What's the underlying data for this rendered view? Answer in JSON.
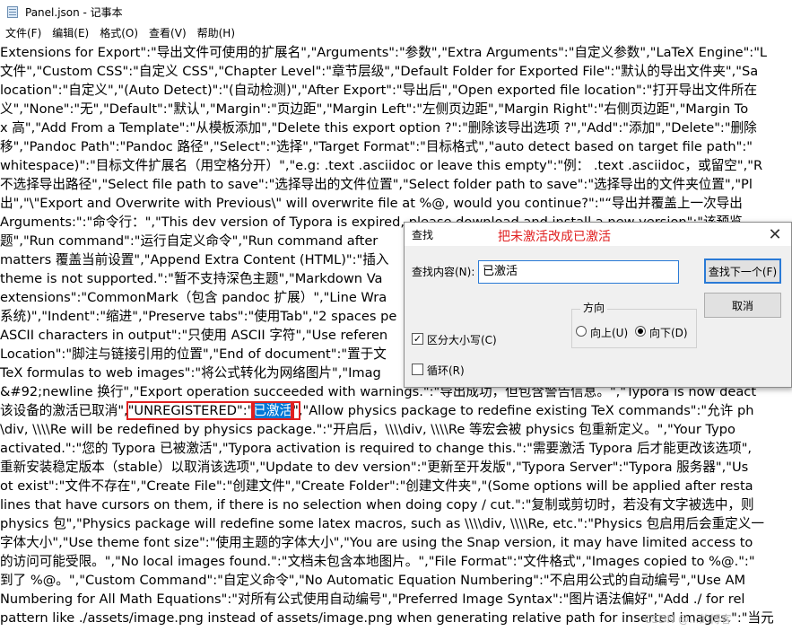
{
  "window": {
    "title": "Panel.json - 记事本",
    "icon": "notepad-icon"
  },
  "menu": [
    {
      "label": "文件(F)"
    },
    {
      "label": "编辑(E)"
    },
    {
      "label": "格式(O)"
    },
    {
      "label": "查看(V)"
    },
    {
      "label": "帮助(H)"
    }
  ],
  "editor": {
    "lines": [
      [
        "Extensions for Export\":\"导出文件可使用的扩展名\",\"Arguments\":\"参数\",\"Extra Arguments\":\"自定义参数\",\"LaTeX Engine\":\"L"
      ],
      [
        "文件\",\"Custom CSS\":\"自定义 CSS\",\"Chapter Level\":\"章节层级\",\"Default Folder for Exported File\":\"默认的导出文件夹\",\"Sa"
      ],
      [
        "location\":\"自定义\",\"(Auto Detect)\":\"(自动检测)\",\"After Export\":\"导出后\",\"Open exported file location\":\"打开导出文件所在"
      ],
      [
        "义\",\"None\":\"无\",\"Default\":\"默认\",\"Margin\":\"页边距\",\"Margin Left\":\"左侧页边距\",\"Margin Right\":\"右侧页边距\",\"Margin To"
      ],
      [
        "x 高\",\"Add From a Template\":\"从模板添加\",\"Delete this export option ?\":\"删除该导出选项 ?\",\"Add\":\"添加\",\"Delete\":\"删除"
      ],
      [
        "移\",\"Pandoc Path\":\"Pandoc 路径\",\"Select\":\"选择\",\"Target Format\":\"目标格式\",\"auto detect based on target file path\":\""
      ],
      [
        "whitespace)\":\"目标文件扩展名（用空格分开）\",\"e.g: .text .asciidoc or leave this empty\":\"例： .text .asciidoc，或留空\",\"R"
      ],
      [
        "不选择导出路径\",\"Select file path to save\":\"选择导出的文件位置\",\"Select folder path to save\":\"选择导出的文件夹位置\",\"Pl"
      ],
      [
        "出\",\"\\\"Export and Overwrite with Previous\\\" will overwrite file at %@, would you continue?\":\"“导出并覆盖上一次导出"
      ],
      [
        "Arguments:\":\"命令行：\",\"This dev version of Typora is expired, please download and install a new version\":\"该预览"
      ],
      [
        "题\",\"Run command\":\"运行自定义命令\",\"Run command after"
      ],
      [
        "matters 覆盖当前设置\",\"Append Extra Content (HTML)\":\"插入"
      ],
      [
        "theme is not supported.\":\"暂不支持深色主题\",\"Markdown Va"
      ],
      [
        "extensions\":\"CommonMark（包含 pandoc 扩展）\",\"Line Wra"
      ],
      [
        "系统)\",\"Indent\":\"缩进\",\"Preserve tabs\":\"使用Tab\",\"2 spaces pe"
      ],
      [
        "ASCII characters in output\":\"只使用 ASCII 字符\",\"Use referen"
      ],
      [
        "Location\":\"脚注与链接引用的位置\",\"End of document\":\"置于文"
      ],
      [
        "TeX formulas to web images\":\"将公式转化为网络图片\",\"Imag"
      ],
      [
        "&#92;newline 换行\",\"Export operation succeeded with warnings.\":\"导出成功，但包含警告信息。\",\"Typora is now deact"
      ],
      [
        "该设备的激活已取消\",",
        "\"UNREGISTERED\":\"",
        "已激活",
        "\"",
        ",\"Allow physics package to redefine existing TeX commands\":\"允许 ph"
      ],
      [
        "\\div, \\\\\\\\Re will be redefined by physics package.\":\"开启后，\\\\\\\\div, \\\\\\\\Re 等宏会被 physics 包重新定义。\",\"Your Typo"
      ],
      [
        "activated.\":\"您的 Typora 已被激活\",\"Typora activation is required to change this.\":\"需要激活 Typora 后才能更改该选项\","
      ],
      [
        "重新安装稳定版本（stable）以取消该选项\",\"Update to dev version\":\"更新至开发版\",\"Typora Server\":\"Typora 服务器\",\"Us"
      ],
      [
        "ot exist\":\"文件不存在\",\"Create File\":\"创建文件\",\"Create Folder\":\"创建文件夹\",\"(Some options will be applied after resta"
      ],
      [
        "lines that have cursors on them, if there is no selection when doing copy / cut.\":\"复制或剪切时，若没有文字被选中，则"
      ],
      [
        "physics 包\",\"Physics package will redefine some latex macros, such as \\\\\\\\div, \\\\\\\\Re, etc.\":\"Physics 包启用后会重定义一"
      ],
      [
        "字体大小\",\"Use theme font size\":\"使用主题的字体大小\",\"You are using the Snap version, it may have limited access to"
      ],
      [
        "的访问可能受限。\",\"No local images found.\":\"文档未包含本地图片。\",\"File Format\":\"文件格式\",\"Images copied to %@.\":\""
      ],
      [
        "到了 %@。\",\"Custom Command\":\"自定义命令\",\"No Automatic Equation Numbering\":\"不启用公式的自动编号\",\"Use AM"
      ],
      [
        "Numbering for All Math Equations\":\"对所有公式使用自动编号\",\"Preferred Image Syntax\":\"图片语法偏好\",\"Add ./ for rel"
      ],
      [
        "pattern like ./assets/image.png instead of assets/image.png when generating relative path for inserted images.\":\"当元"
      ]
    ]
  },
  "find_dialog": {
    "title": "查找",
    "annotation": "把未激活改成已激活",
    "find_label": "查找内容(N):",
    "find_value": "已激活",
    "find_next_label": "查找下一个(F)",
    "cancel_label": "取消",
    "direction_label": "方向",
    "up_label": "向上(U)",
    "down_label": "向下(D)",
    "direction_selected": "down",
    "match_case_label": "区分大小写(C)",
    "match_case_checked": true,
    "wrap_label": "循环(R)",
    "wrap_checked": false,
    "close_glyph": "✕"
  },
  "watermark": "CSDN @...的博客"
}
